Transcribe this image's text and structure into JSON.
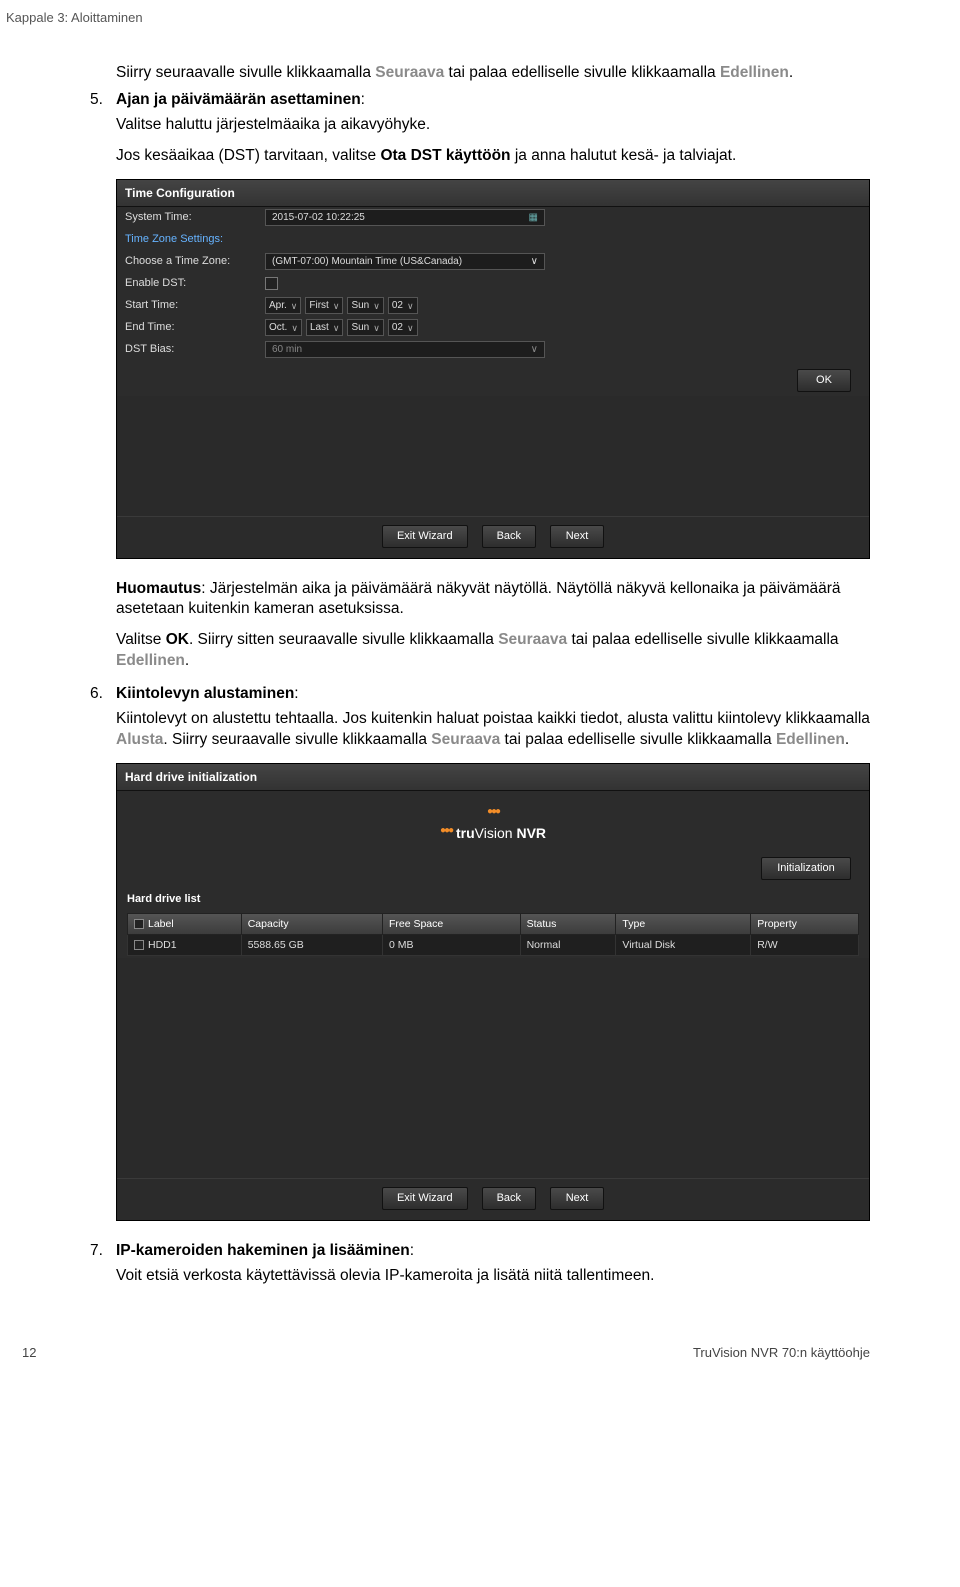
{
  "header": {
    "breadcrumb": "Kappale 3: Aloittaminen"
  },
  "intro_paragraph": {
    "pre": "Siirry seuraavalle sivulle klikkaamalla ",
    "link1": "Seuraava",
    "mid": " tai palaa edelliselle sivulle klikkaamalla ",
    "link2": "Edellinen",
    "post": "."
  },
  "step5": {
    "num": "5.",
    "title": "Ajan ja päivämäärän asettaminen",
    "colon": ":",
    "p1": "Valitse haluttu järjestelmäaika ja aikavyöhyke.",
    "p2_pre": "Jos kesäaikaa (DST) tarvitaan, valitse ",
    "p2_bold": "Ota DST käyttöön",
    "p2_post": " ja anna halutut kesä- ja talviajat."
  },
  "time_panel": {
    "title": "Time Configuration",
    "rows": {
      "system_time_label": "System Time:",
      "system_time_value": "2015-07-02 10:22:25",
      "tz_settings_label": "Time Zone Settings:",
      "choose_tz_label": "Choose a Time Zone:",
      "choose_tz_value": "(GMT-07:00) Mountain Time (US&Canada)",
      "enable_dst_label": "Enable DST:",
      "start_time_label": "Start Time:",
      "start_month": "Apr.",
      "start_week": "First",
      "start_day": "Sun",
      "start_hour": "02",
      "end_time_label": "End Time:",
      "end_month": "Oct.",
      "end_week": "Last",
      "end_day": "Sun",
      "end_hour": "02",
      "dst_bias_label": "DST Bias:",
      "dst_bias_value": "60 min"
    },
    "ok_button": "OK",
    "footer": {
      "exit": "Exit Wizard",
      "back": "Back",
      "next": "Next"
    }
  },
  "after_time_panel": {
    "p1_pre": "Huomautus",
    "p1_post": ": Järjestelmän aika ja päivämäärä näkyvät näytöllä. Näytöllä näkyvä kellonaika ja päivämäärä asetetaan kuitenkin kameran asetuksissa.",
    "p2_pre": "Valitse ",
    "p2_bold": "OK",
    "p2_mid": ". Siirry sitten seuraavalle sivulle klikkaamalla ",
    "p2_link1": "Seuraava",
    "p2_mid2": " tai palaa edelliselle sivulle klikkaamalla ",
    "p2_link2": "Edellinen",
    "p2_post": "."
  },
  "step6": {
    "num": "6.",
    "title": "Kiintolevyn alustaminen",
    "colon": ":",
    "p_pre": "Kiintolevyt on alustettu tehtaalla. Jos kuitenkin haluat poistaa kaikki tiedot, alusta valittu kiintolevy klikkaamalla ",
    "p_link1": "Alusta",
    "p_mid": ". Siirry seuraavalle sivulle klikkaamalla ",
    "p_link2": "Seuraava",
    "p_mid2": " tai palaa edelliselle sivulle klikkaamalla ",
    "p_link3": "Edellinen",
    "p_post": "."
  },
  "hdd_panel": {
    "title": "Hard drive initialization",
    "logo": "truVision  NVR",
    "init_button": "Initialization",
    "list_title": "Hard drive list",
    "columns": {
      "label": "Label",
      "capacity": "Capacity",
      "free": "Free Space",
      "status": "Status",
      "type": "Type",
      "property": "Property"
    },
    "rows": [
      {
        "label": "HDD1",
        "capacity": "5588.65 GB",
        "free": "0 MB",
        "status": "Normal",
        "type": "Virtual Disk",
        "property": "R/W"
      }
    ],
    "footer": {
      "exit": "Exit Wizard",
      "back": "Back",
      "next": "Next"
    }
  },
  "step7": {
    "num": "7.",
    "title": "IP-kameroiden hakeminen ja lisääminen",
    "colon": ":",
    "p": "Voit etsiä verkosta käytettävissä olevia IP-kameroita ja lisätä niitä tallentimeen."
  },
  "footer": {
    "page_num": "12",
    "doc_name": "TruVision NVR 70:n käyttöohje"
  }
}
